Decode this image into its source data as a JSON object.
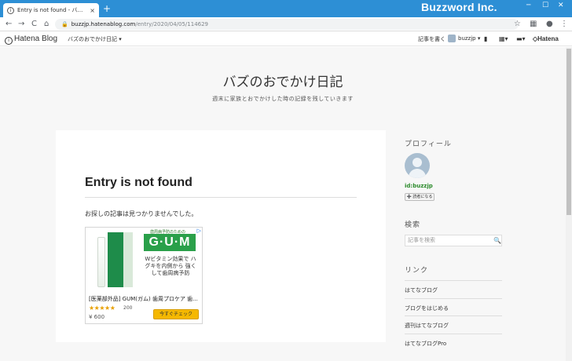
{
  "browser": {
    "tab_title": "Entry is not found - バズのおでか",
    "new_tab": "+",
    "tab_close": "×",
    "watermark": "Buzzword Inc.",
    "window_controls": [
      "─",
      "☐",
      "✕"
    ],
    "url_host": "buzzjp.hatenablog.com",
    "url_path": "/entry/2020/04/05/114629",
    "nav_icons": [
      "back-icon",
      "forward-icon",
      "reload-icon",
      "home-icon"
    ],
    "nav_glyphs": [
      "←",
      "→",
      "C",
      "⌂"
    ],
    "right_icons": [
      "star-icon",
      "extension-icon",
      "profile-icon",
      "menu-icon"
    ]
  },
  "hatena_bar": {
    "logo": "Hatena Blog",
    "blog_name": "バズのおでかけ日記 ▾",
    "write": "記事を書く",
    "user": "buzzjp ▾",
    "hatena": "◇Hatena"
  },
  "blog": {
    "title": "バズのおでかけ日記",
    "description": "週末に家族とおでかけした時の記録を残していきます"
  },
  "entry": {
    "title": "Entry is not found",
    "message": "お探しの記事は見つかりませんでした。"
  },
  "ad": {
    "badge": "▷",
    "brand_small": "歯周病予防のための",
    "brand": "G·U·M",
    "copy": "Wビタミン効果で ハグキを内側から 強くして歯周病予防",
    "product": "[医薬部外品] GUM(ガム) 歯周プロケア 歯...",
    "stars": "★★★★★",
    "rating": 4.5,
    "reviews": "200",
    "price": "¥ 600",
    "button": "今すぐチェック"
  },
  "sidebar": {
    "profile_heading": "プロフィール",
    "user_id": "id:buzzjp",
    "follow": "➕ 読者になる",
    "search_heading": "検索",
    "search_placeholder": "記事を検索",
    "links_heading": "リンク",
    "links": [
      "はてなブログ",
      "ブログをはじめる",
      "週刊はてなブログ",
      "はてなブログPro"
    ]
  }
}
